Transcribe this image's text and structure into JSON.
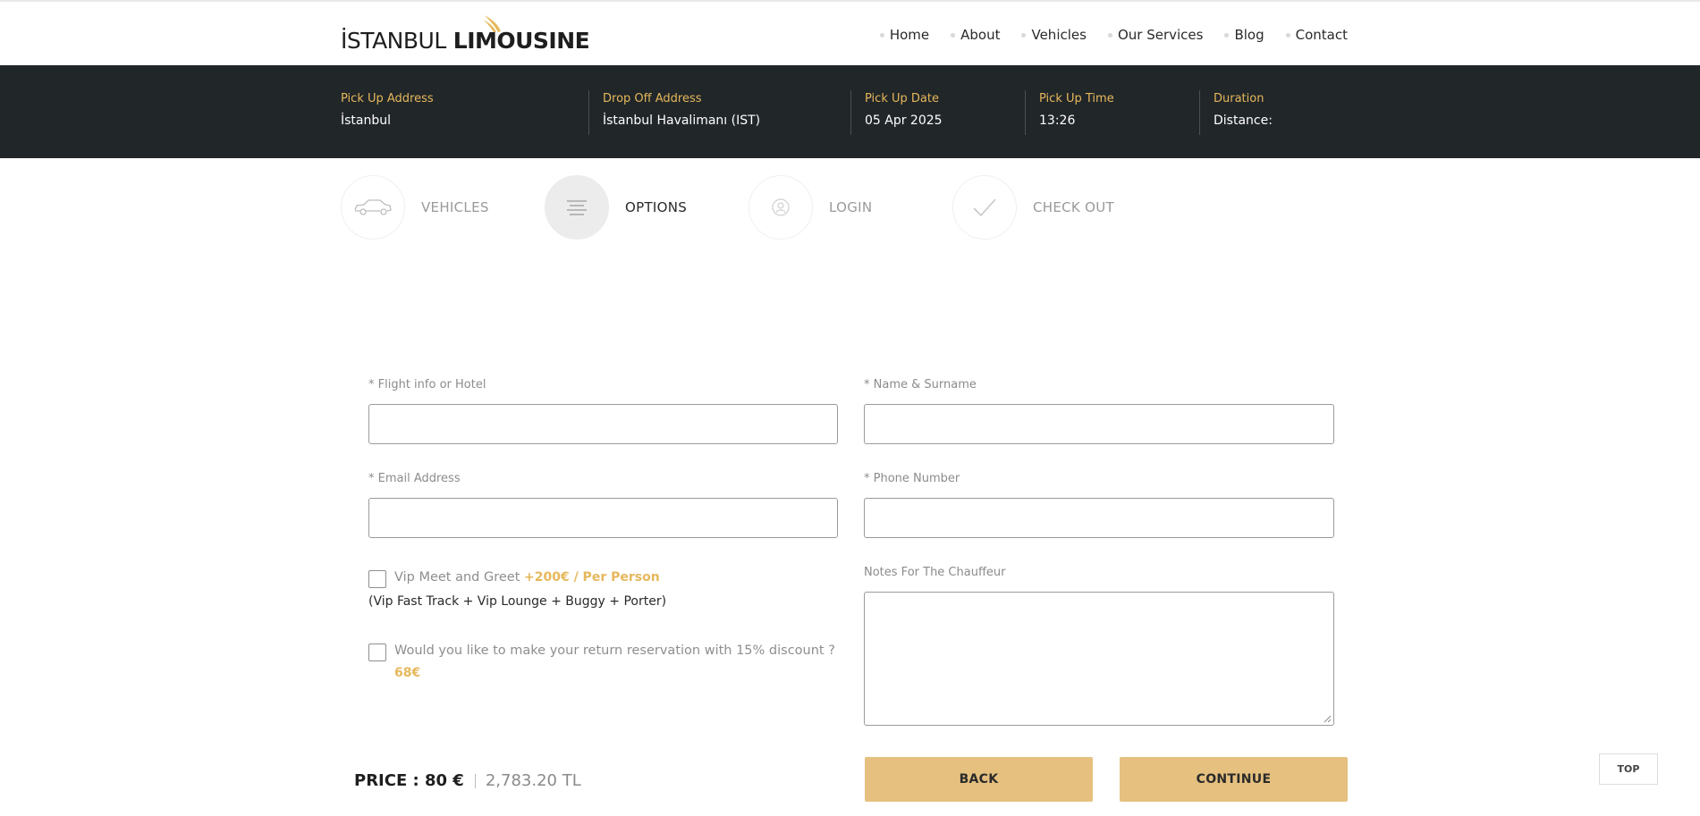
{
  "brand": {
    "part1": "İSTANBUL",
    "part2": "LIMOUSINE",
    "accent": "#e6b85c"
  },
  "nav": [
    "Home",
    "About",
    "Vehicles",
    "Our Services",
    "Blog",
    "Contact"
  ],
  "summary": {
    "pickup_address": {
      "label": "Pick Up Address",
      "value": "İstanbul"
    },
    "dropoff_address": {
      "label": "Drop Off Address",
      "value": "İstanbul Havalimanı (IST)"
    },
    "pickup_date": {
      "label": "Pick Up Date",
      "value": "05 Apr 2025"
    },
    "pickup_time": {
      "label": "Pick Up Time",
      "value": "13:26"
    },
    "duration": {
      "label": "Duration",
      "value": "Distance:"
    }
  },
  "steps": [
    {
      "label": "VEHICLES",
      "icon": "car-icon",
      "active": false
    },
    {
      "label": "OPTIONS",
      "icon": "list-icon",
      "active": true
    },
    {
      "label": "LOGIN",
      "icon": "user-icon",
      "active": false
    },
    {
      "label": "CHECK OUT",
      "icon": "check-icon",
      "active": false
    }
  ],
  "form": {
    "flight_label": "* Flight info or Hotel",
    "name_label": "* Name & Surname",
    "email_label": "* Email Address",
    "phone_label": "* Phone Number",
    "notes_label": "Notes For The Chauffeur",
    "vip_label": "Vip Meet and Greet",
    "vip_price": "+200€ / Per Person",
    "vip_sub": "(Vip Fast Track + Vip Lounge + Buggy + Porter)",
    "return_label": "Would you like to make your return reservation with 15% discount ?",
    "return_price": "68€"
  },
  "price": {
    "main": "PRICE : 80 €",
    "tl": "2,783.20 TL"
  },
  "buttons": {
    "back": "BACK",
    "continue": "CONTINUE",
    "top": "TOP"
  }
}
